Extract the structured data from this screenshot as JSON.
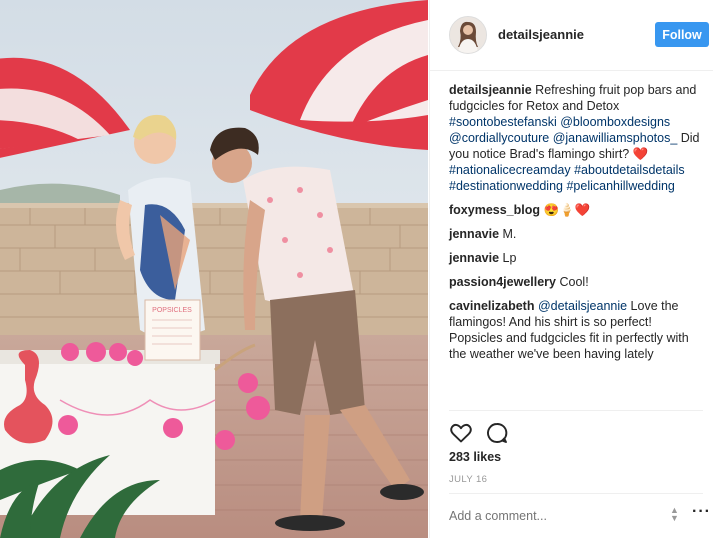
{
  "post": {
    "username": "detailsjeannie",
    "follow_label": "Follow",
    "photo_alt": "",
    "sign_title": "POPSICLES"
  },
  "comments": [
    {
      "user": "detailsjeannie",
      "parts": [
        {
          "t": "Refreshing fruit pop bars and fudgcicles for Retox and Detox ",
          "tag": false
        },
        {
          "t": "#soontobestefanski",
          "tag": true
        },
        {
          "t": " ",
          "tag": false
        },
        {
          "t": "@bloomboxdesigns",
          "tag": true
        },
        {
          "t": " ",
          "tag": false
        },
        {
          "t": "@cordiallycouture",
          "tag": true
        },
        {
          "t": " ",
          "tag": false
        },
        {
          "t": "@janawilliamsphotos_",
          "tag": true
        },
        {
          "t": " Did you notice Brad's flamingo shirt? ❤️ ",
          "tag": false
        },
        {
          "t": "#nationalicecreamday",
          "tag": true
        },
        {
          "t": " ",
          "tag": false
        },
        {
          "t": "#aboutdetailsdetails",
          "tag": true
        },
        {
          "t": " ",
          "tag": false
        },
        {
          "t": "#destinationwedding",
          "tag": true
        },
        {
          "t": " ",
          "tag": false
        },
        {
          "t": "#pelicanhillwedding",
          "tag": true
        }
      ]
    },
    {
      "user": "foxymess_blog",
      "parts": [
        {
          "t": "😍🍦❤️",
          "tag": false
        }
      ]
    },
    {
      "user": "jennavie",
      "parts": [
        {
          "t": "M.",
          "tag": false
        }
      ]
    },
    {
      "user": "jennavie",
      "parts": [
        {
          "t": "Lp",
          "tag": false
        }
      ]
    },
    {
      "user": "passion4jewellery",
      "parts": [
        {
          "t": "Cool!",
          "tag": false
        }
      ]
    },
    {
      "user": "cavinelizabeth",
      "parts": [
        {
          "t": "@detailsjeannie",
          "tag": true
        },
        {
          "t": " Love the flamingos! And his shirt is so perfect! Popsicles and fudgcicles fit in perfectly with the weather we've been having lately",
          "tag": false
        }
      ]
    }
  ],
  "actions": {
    "like_icon": "heart-icon",
    "comment_icon": "comment-icon",
    "likes": "283 likes",
    "date": "JULY 16"
  },
  "composer": {
    "placeholder": "Add a comment...",
    "more_icon": "more-options-icon"
  },
  "colors": {
    "accent": "#3897f0",
    "link": "#003569",
    "muted": "#999999"
  }
}
